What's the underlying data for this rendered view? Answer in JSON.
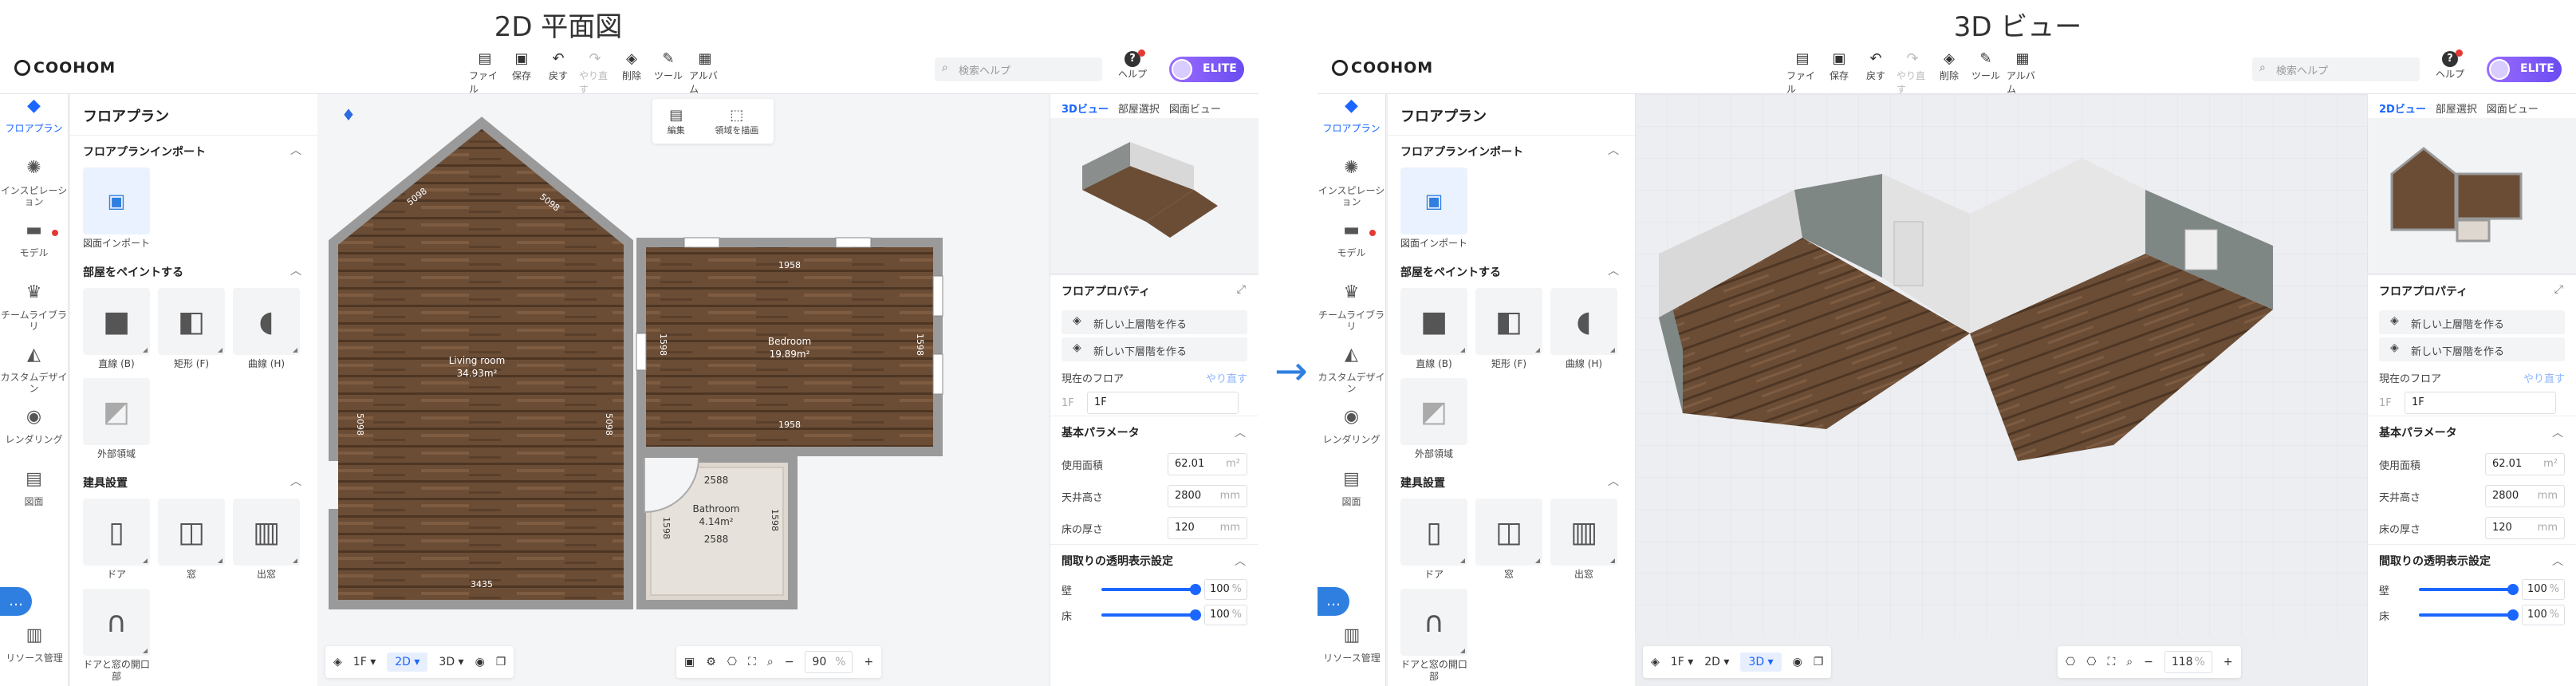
{
  "captions": {
    "left": "2D 平面図",
    "right": "3D ビュー"
  },
  "arrow": "→",
  "brand": "COOHOM",
  "toolbar": [
    {
      "icon": "file-icon",
      "label": "ファイル",
      "glyph": "▤"
    },
    {
      "icon": "save-icon",
      "label": "保存",
      "glyph": "▣"
    },
    {
      "icon": "undo-icon",
      "label": "戻す",
      "glyph": "↶"
    },
    {
      "icon": "redo-icon",
      "label": "やり直す",
      "glyph": "↷"
    },
    {
      "icon": "delete-icon",
      "label": "削除",
      "glyph": "◈"
    },
    {
      "icon": "tool-icon",
      "label": "ツール",
      "glyph": "✎"
    },
    {
      "icon": "album-icon",
      "label": "アルバム",
      "glyph": "▦"
    }
  ],
  "search": {
    "placeholder": "検索ヘルプ"
  },
  "help": {
    "label": "ヘルプ"
  },
  "elite": {
    "label": "ELITE"
  },
  "leftnav": [
    {
      "icon": "floorplan-icon",
      "label": "フロアプラン",
      "glyph": "◆"
    },
    {
      "icon": "inspiration-icon",
      "label": "インスピレーション",
      "glyph": "✺"
    },
    {
      "icon": "model-icon",
      "label": "モデル",
      "glyph": "▬"
    },
    {
      "icon": "team-library-icon",
      "label": "チームライブラリ",
      "glyph": "♛"
    },
    {
      "icon": "custom-design-icon",
      "label": "カスタムデザイン",
      "glyph": "◭"
    },
    {
      "icon": "rendering-icon",
      "label": "レンダリング",
      "glyph": "◉"
    },
    {
      "icon": "drawing-icon",
      "label": "図面",
      "glyph": "▤"
    },
    {
      "icon": "resource-icon",
      "label": "リソース管理",
      "glyph": "▥"
    }
  ],
  "panel": {
    "title": "フロアプラン",
    "import_section": "フロアプランインポート",
    "import_card": "図面インポート",
    "paint_section": "部屋をペイントする",
    "paint_cards": [
      "直線 (B)",
      "矩形 (F)",
      "曲線 (H)",
      "外部領域"
    ],
    "fixture_section": "建具設置",
    "fixture_cards": [
      "ドア",
      "窓",
      "出窓",
      "ドアと窓の開口部"
    ]
  },
  "editbox": {
    "edit": "編集",
    "draw": "領域を描画"
  },
  "right_tabs_left": [
    "3Dビュー",
    "部屋選択",
    "図面ビュー"
  ],
  "right_tabs_right": [
    "2Dビュー",
    "部屋選択",
    "図面ビュー"
  ],
  "props": {
    "title": "フロアプロパティ",
    "new_upper": "新しい上層階を作る",
    "new_lower": "新しい下層階を作る",
    "current_floor_label": "現在のフロア",
    "redo": "やり直す",
    "floor_prefix": "1F",
    "floor_value": "1F",
    "basic_params": "基本パラメータ",
    "area_label": "使用面積",
    "area_value": "62.01",
    "area_unit": "m²",
    "ceiling_label": "天井高さ",
    "ceiling_value": "2800",
    "ceiling_unit": "mm",
    "floor_thick_label": "床の厚さ",
    "floor_thick_value": "120",
    "floor_thick_unit": "mm",
    "transparency": "間取りの透明表示設定",
    "wall_label": "壁",
    "wall_value": "100",
    "floor_label": "床",
    "floor_value_pct": "100",
    "pct": "%"
  },
  "rooms": {
    "living": "Living room",
    "living_area": "34.93m²",
    "bedroom": "Bedroom",
    "bedroom_area": "19.89m²",
    "bathroom": "Bathroom",
    "bathroom_area": "4.14m²"
  },
  "dims": {
    "d1": "2588",
    "d2": "2588",
    "d3": "1598",
    "d4": "1598",
    "d5": "5098",
    "d6": "5098",
    "d7": "5098",
    "d8": "5098",
    "d9": "3435",
    "d10": "1958",
    "d11": "1958",
    "d12": "1598",
    "d13": "1598"
  },
  "bottom_left": {
    "floor": "1F",
    "mode2d": "2D",
    "mode3d": "3D",
    "zoom": "90",
    "pct": "%"
  },
  "bottom_right": {
    "floor": "1F",
    "mode2d": "2D",
    "mode3d": "3D",
    "zoom": "118",
    "pct": "%"
  },
  "colors": {
    "accent": "#1a66ff",
    "floor_wood": "#6b4d36",
    "wall_gray": "#7f8784"
  }
}
